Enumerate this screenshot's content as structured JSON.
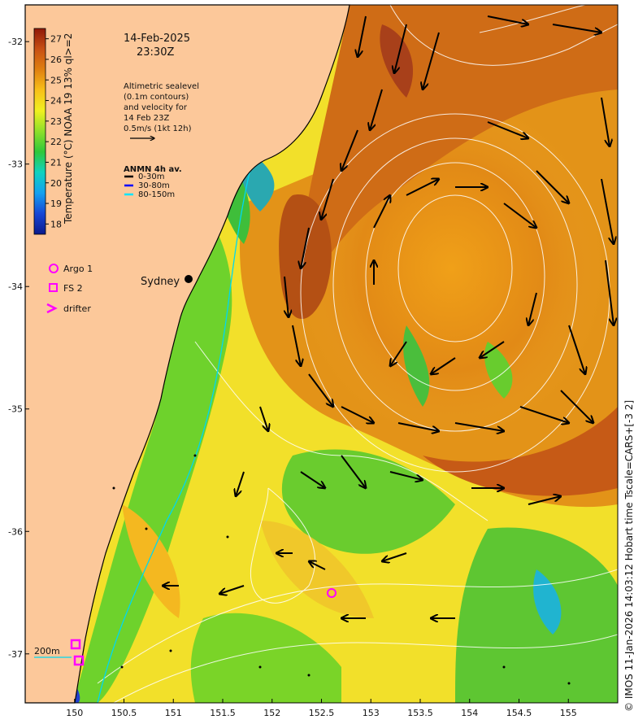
{
  "header": {
    "date": "14-Feb-2025",
    "time": "23:30Z"
  },
  "info": {
    "lines": [
      "Altimetric sealevel",
      "(0.1m contours)",
      "and velocity for",
      "14 Feb 23Z",
      "0.5m/s (1kt 12h)"
    ]
  },
  "anmn": {
    "title": "ANMN 4h av.",
    "items": [
      {
        "label": "0-30m",
        "color": "#000000"
      },
      {
        "label": "30-80m",
        "color": "#0000ff"
      },
      {
        "label": "80-150m",
        "color": "#00e5ff"
      }
    ]
  },
  "markers_legend": [
    {
      "label": "Argo 1",
      "icon": "circle-icon"
    },
    {
      "label": "FS 2",
      "icon": "square-icon"
    },
    {
      "label": "drifter",
      "icon": "chevron-icon"
    }
  ],
  "colorbar": {
    "label": "Temperature (°C) NOAA 19 13% ql>=2",
    "ticks": [
      18,
      19,
      20,
      21,
      22,
      23,
      24,
      25,
      26,
      27
    ],
    "min": 17.5,
    "max": 27.5
  },
  "map": {
    "lon_range": [
      149.5,
      155.5
    ],
    "lat_range": [
      -37.4,
      -31.7
    ],
    "x_ticks": [
      "150",
      "150.5",
      "151",
      "151.5",
      "152",
      "152.5",
      "153",
      "153.5",
      "154",
      "154.5",
      "155"
    ],
    "y_ticks": [
      "-32",
      "-33",
      "-34",
      "-35",
      "-36",
      "-37"
    ],
    "city": "Sydney",
    "depth_label": "200m",
    "land_color": "#fcc89a",
    "marker_color": "#ff00ff"
  },
  "footer": {
    "credit": "© IMOS 11-Jan-2026 14:03:12 Hobart time Tscale=CARS+[-3 2]"
  }
}
